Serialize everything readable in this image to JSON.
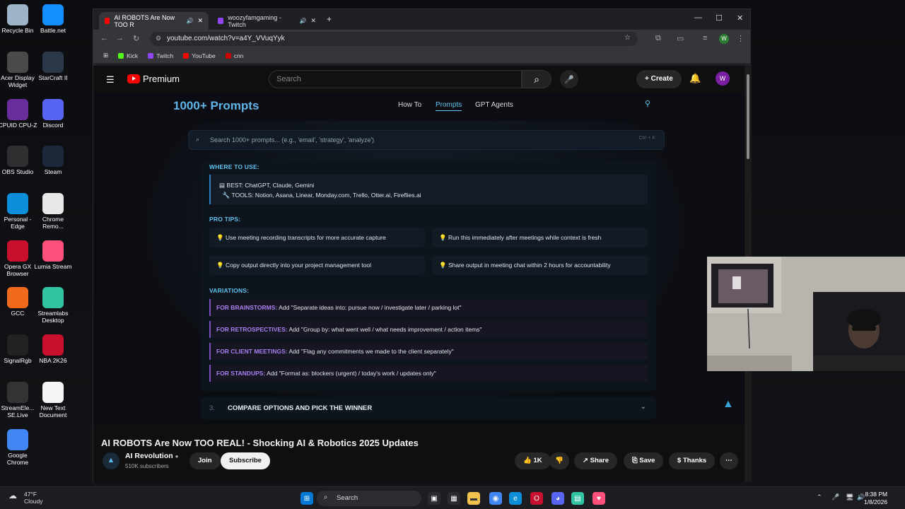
{
  "desktop_icons": [
    {
      "label": "Recycle Bin",
      "color": "#9fb3c8"
    },
    {
      "label": "Battle.net",
      "color": "#148eff"
    },
    {
      "label": "Acer Display Widget",
      "color": "#4a4a4a"
    },
    {
      "label": "StarCraft II",
      "color": "#2a3848"
    },
    {
      "label": "CPUID CPU-Z",
      "color": "#6a2d9c"
    },
    {
      "label": "Discord",
      "color": "#5865f2"
    },
    {
      "label": "OBS Studio",
      "color": "#302e31"
    },
    {
      "label": "Steam",
      "color": "#1b2838"
    },
    {
      "label": "Personal - Edge",
      "color": "#0c8ed9"
    },
    {
      "label": "Chrome Remo...",
      "color": "#e8e8e8"
    },
    {
      "label": "Opera GX Browser",
      "color": "#c8102e"
    },
    {
      "label": "Lumia Stream",
      "color": "#ff4f7b"
    },
    {
      "label": "GCC",
      "color": "#f26b1d"
    },
    {
      "label": "Streamlabs Desktop",
      "color": "#31c3a2"
    },
    {
      "label": "SignalRgb",
      "color": "#222222"
    },
    {
      "label": "NBA 2K26",
      "color": "#c8102e"
    },
    {
      "label": "StreamEle... SE.Live",
      "color": "#333333"
    },
    {
      "label": "New Text Document",
      "color": "#f5f5f5"
    },
    {
      "label": "Google Chrome",
      "color": "#4285f4"
    }
  ],
  "browser": {
    "tabs": [
      {
        "title": "AI ROBOTS Are Now TOO R",
        "favicon_color": "#ff0000"
      },
      {
        "title": "woozyfamgaming - Twitch",
        "favicon_color": "#9146ff"
      }
    ],
    "url": "youtube.com/watch?v=a4Y_VVuqYyk",
    "profile_initial": "W",
    "bookmarks": [
      {
        "label": "Kick",
        "color": "#53fc18"
      },
      {
        "label": "Twitch",
        "color": "#9146ff"
      },
      {
        "label": "YouTube",
        "color": "#ff0000"
      },
      {
        "label": "cnn",
        "color": "#cc0000"
      }
    ]
  },
  "youtube": {
    "brand": "Premium",
    "search_placeholder": "Search",
    "create_label": "Create",
    "avatar_initial": "W"
  },
  "video": {
    "site_title": "1000+ Prompts",
    "nav": [
      "How To",
      "Prompts",
      "GPT Agents"
    ],
    "search_placeholder": "Search 1000+ prompts... (e.g., 'email', 'strategy', 'analyze')",
    "search_shortcut": "Ctrl + K",
    "where_heading": "WHERE TO USE:",
    "best_line": "BEST: ChatGPT, Claude, Gemini",
    "tools_line": "TOOLS: Notion, Asana, Linear, Monday.com, Trello, Otter.ai, Fireflies.ai",
    "pro_tips_heading": "PRO TIPS:",
    "tips": [
      "Use meeting recording transcripts for more accurate capture",
      "Run this immediately after meetings while context is fresh",
      "Copy output directly into your project management tool",
      "Share output in meeting chat within 2 hours for accountability"
    ],
    "variations_heading": "VARIATIONS:",
    "variations": [
      {
        "label": "FOR BRAINSTORMS:",
        "text": "Add \"Separate ideas into: pursue now / investigate later / parking lot\""
      },
      {
        "label": "FOR RETROSPECTIVES:",
        "text": "Add \"Group by: what went well / what needs improvement / action items\""
      },
      {
        "label": "FOR CLIENT MEETINGS:",
        "text": "Add \"Flag any commitments we made to the client separately\""
      },
      {
        "label": "FOR STANDUPS:",
        "text": "Add \"Format as: blockers (urgent) / today's work / updates only\""
      }
    ],
    "accordion_number": "3.",
    "accordion_label": "COMPARE OPTIONS AND PICK THE WINNER"
  },
  "watch": {
    "title": "AI ROBOTS Are Now TOO REAL! - Shocking AI & Robotics 2025 Updates",
    "channel": "AI Revolution",
    "subscribers": "510K subscribers",
    "join_label": "Join",
    "subscribe_label": "Subscribe",
    "likes": "1K",
    "share_label": "Share",
    "save_label": "Save",
    "thanks_label": "Thanks"
  },
  "taskbar": {
    "weather_temp": "47°F",
    "weather_desc": "Cloudy",
    "search_label": "Search",
    "time": "8:38 PM",
    "date": "1/8/2026"
  }
}
